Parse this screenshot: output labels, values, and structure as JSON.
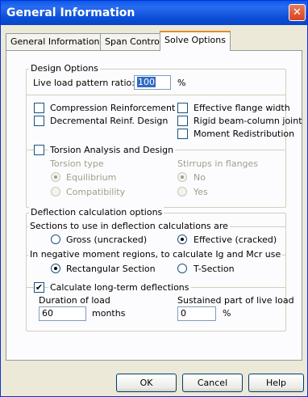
{
  "window": {
    "title": "General Information",
    "close_glyph": "✕"
  },
  "tabs": [
    {
      "label": "General Information"
    },
    {
      "label": "Span Control"
    },
    {
      "label": "Solve Options"
    }
  ],
  "design_options": {
    "group_label": "Design Options",
    "live_load_label": "Live load pattern ratio:",
    "live_load_value": "100",
    "live_load_unit": "%",
    "compression_reinforcement": {
      "label": "Compression Reinforcement",
      "checked": false
    },
    "decremental_reinf": {
      "label": "Decremental Reinf. Design",
      "checked": false
    },
    "effective_flange_width": {
      "label": "Effective flange width",
      "checked": false
    },
    "rigid_joint": {
      "label": "Rigid beam-column joint",
      "checked": false
    },
    "moment_redistribution": {
      "label": "Moment Redistribution",
      "checked": false
    },
    "torsion": {
      "label": "Torsion Analysis and Design",
      "checked": false,
      "type_label": "Torsion type",
      "equilibrium_label": "Equilibrium",
      "compatibility_label": "Compatibility",
      "stirrups_label": "Stirrups in flanges",
      "no_label": "No",
      "yes_label": "Yes"
    }
  },
  "deflection": {
    "group_label": "Deflection calculation options",
    "sections_label": "Sections to use in deflection calculations are",
    "gross_label": "Gross (uncracked)",
    "effective_label": "Effective (cracked)",
    "negative_moment_label": "In negative moment regions, to calculate Ig and Mcr use",
    "rectangular_label": "Rectangular Section",
    "tsection_label": "T-Section",
    "long_term_label": "Calculate long-term deflections",
    "long_term_checked": true,
    "duration_label": "Duration of load",
    "duration_value": "60",
    "duration_unit": "months",
    "sustained_label": "Sustained part of live load",
    "sustained_value": "0",
    "sustained_unit": "%"
  },
  "buttons": {
    "ok": "OK",
    "cancel": "Cancel",
    "help": "Help"
  }
}
